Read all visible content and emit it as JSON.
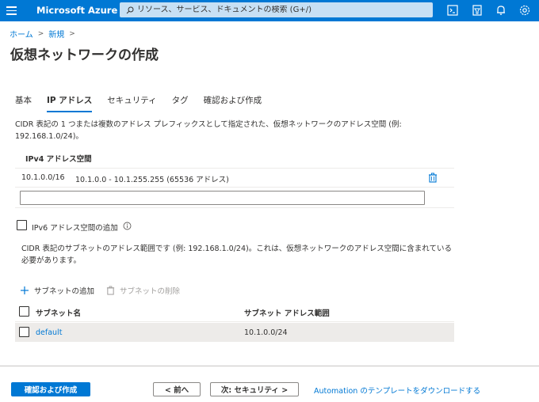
{
  "header": {
    "brand": "Microsoft Azure",
    "search_placeholder": "リソース、サービス、ドキュメントの検索 (G+/)",
    "icons": [
      "cloud-shell-icon",
      "directory-filter-icon",
      "bell-icon",
      "settings-icon"
    ]
  },
  "breadcrumb": {
    "items": [
      "ホーム",
      "新規"
    ]
  },
  "page_title": "仮想ネットワークの作成",
  "tabs": [
    {
      "label": "基本",
      "active": false
    },
    {
      "label": "IP アドレス",
      "active": true
    },
    {
      "label": "セキュリティ",
      "active": false
    },
    {
      "label": "タグ",
      "active": false
    },
    {
      "label": "確認および作成",
      "active": false
    }
  ],
  "description": "CIDR 表記の 1 つまたは複数のアドレス プレフィックスとして指定された、仮想ネットワークのアドレス空間 (例: 192.168.1.0/24)。",
  "ipv4": {
    "header": "IPv4 アドレス空間",
    "row": {
      "cidr": "10.1.0.0/16",
      "range": "10.1.0.0 - 10.1.255.255 (65536 アドレス)"
    },
    "new_value": ""
  },
  "ipv6": {
    "label": "IPv6 アドレス空間の追加",
    "checked": false
  },
  "subnet_description": "CIDR 表記のサブネットのアドレス範囲です (例: 192.168.1.0/24)。これは、仮想ネットワークのアドレス空間に含まれている必要があります。",
  "subnet_actions": {
    "add": "サブネットの追加",
    "delete": "サブネットの削除"
  },
  "subnet_table": {
    "columns": [
      "サブネット名",
      "サブネット アドレス範囲"
    ],
    "rows": [
      {
        "name": "default",
        "range": "10.1.0.0/24"
      }
    ]
  },
  "footer": {
    "review_create": "確認および作成",
    "previous": "< 前へ",
    "next": "次: セキュリティ >",
    "download_link": "Automation のテンプレートをダウンロードする"
  },
  "colors": {
    "accent": "#0078d4",
    "search_bg": "#c7e0f4",
    "row_highlight": "#edebe9"
  }
}
